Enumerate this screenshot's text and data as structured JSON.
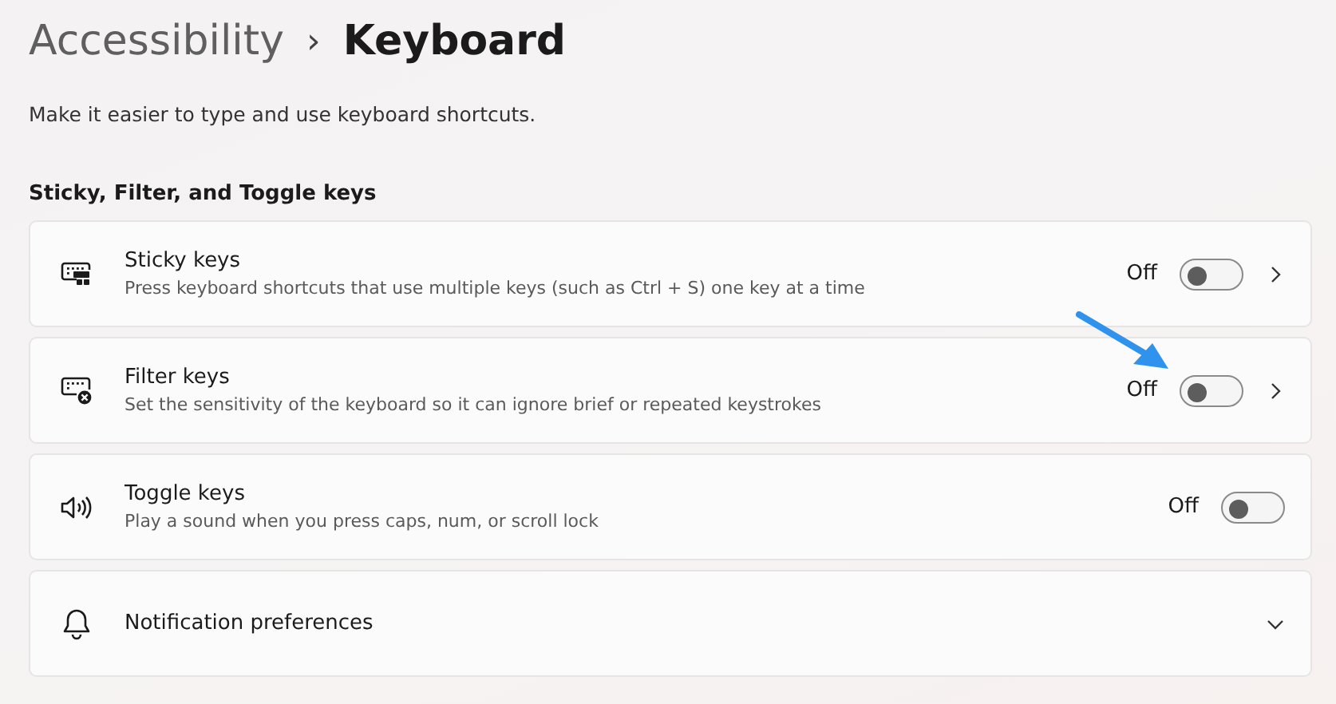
{
  "breadcrumb": {
    "parent": "Accessibility",
    "separator": "›",
    "current": "Keyboard"
  },
  "description": "Make it easier to type and use keyboard shortcuts.",
  "section": {
    "title": "Sticky, Filter, and Toggle keys"
  },
  "items": [
    {
      "kind": "toggle-link",
      "title": "Sticky keys",
      "subtitle": "Press keyboard shortcuts that use multiple keys (such as Ctrl + S) one key at a time",
      "state_label": "Off",
      "on": false
    },
    {
      "kind": "toggle-link",
      "title": "Filter keys",
      "subtitle": "Set the sensitivity of the keyboard so it can ignore brief or repeated keystrokes",
      "state_label": "Off",
      "on": false
    },
    {
      "kind": "toggle",
      "title": "Toggle keys",
      "subtitle": "Play a sound when you press caps, num, or scroll lock",
      "state_label": "Off",
      "on": false
    },
    {
      "kind": "expander",
      "title": "Notification preferences",
      "expanded": false
    }
  ]
}
